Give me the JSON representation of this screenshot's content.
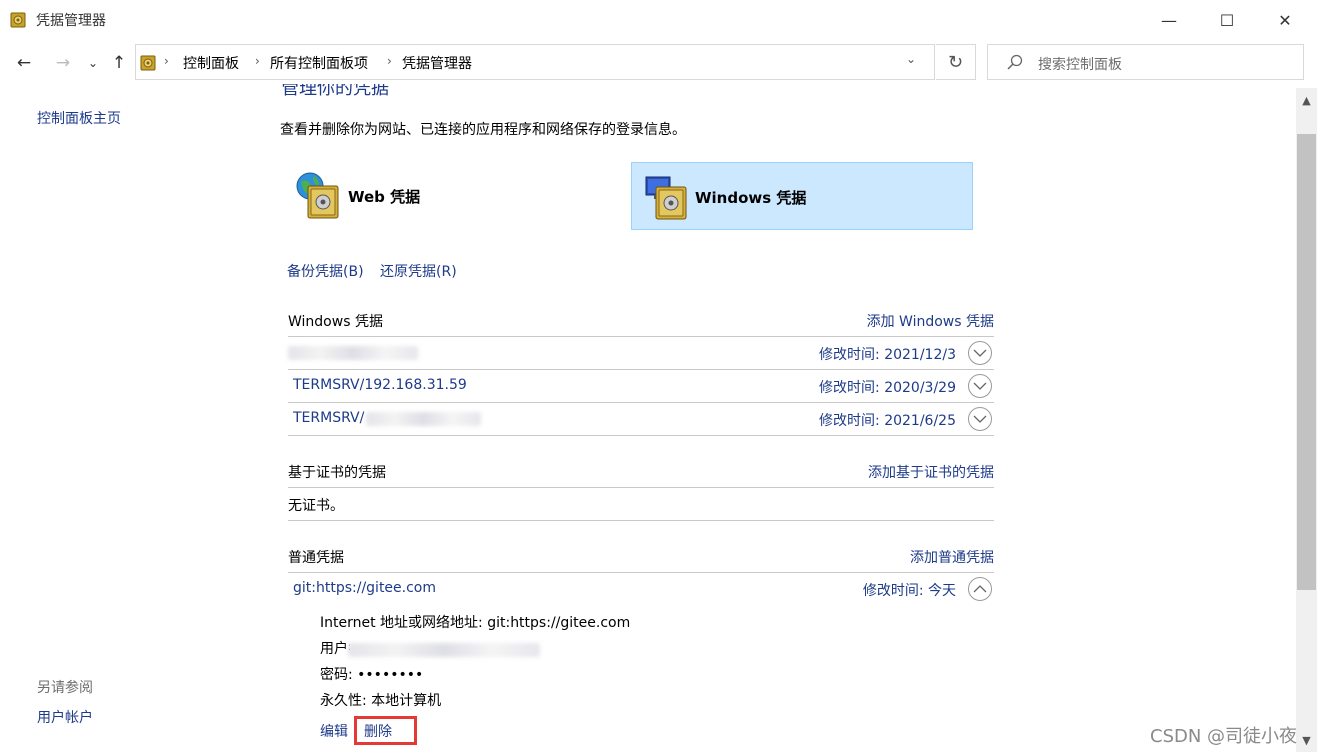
{
  "window": {
    "title": "凭据管理器",
    "minimize_glyph": "—",
    "maximize_glyph": "☐",
    "close_glyph": "✕"
  },
  "nav": {
    "back_glyph": "←",
    "forward_glyph": "→",
    "recent_glyph": "⌄",
    "up_glyph": "↑",
    "breadcrumbs": [
      "控制面板",
      "所有控制面板项",
      "凭据管理器"
    ],
    "separator": "›",
    "dropdown_glyph": "⌄",
    "refresh_glyph": "↻",
    "search_placeholder": "搜索控制面板"
  },
  "sidebar": {
    "home": "控制面板主页",
    "see_also": "另请参阅",
    "user_accounts": "用户帐户"
  },
  "main": {
    "title": "管理你的凭据",
    "description": "查看并删除你为网站、已连接的应用程序和网络保存的登录信息。",
    "tiles": {
      "web": "Web 凭据",
      "windows": "Windows 凭据"
    },
    "selected_tile": "windows",
    "backup": "备份凭据(B)",
    "restore": "还原凭据(R)",
    "windows_section": {
      "title": "Windows 凭据",
      "add": "添加 Windows 凭据",
      "items": [
        {
          "name": "",
          "modified": "修改时间:  2021/12/3"
        },
        {
          "name": "TERMSRV/192.168.31.59",
          "modified": "修改时间:  2020/3/29"
        },
        {
          "name": "TERMSRV/",
          "modified": "修改时间:  2021/6/25"
        }
      ]
    },
    "cert_section": {
      "title": "基于证书的凭据",
      "add": "添加基于证书的凭据",
      "empty": "无证书。"
    },
    "generic_section": {
      "title": "普通凭据",
      "add": "添加普通凭据",
      "items": [
        {
          "name": "git:https://gitee.com",
          "modified": "修改时间:  今天"
        }
      ],
      "expanded": {
        "address": "Internet 地址或网络地址:  git:https://gitee.com",
        "user": "用户名",
        "password": "密码:  ••••••••",
        "persistence": "永久性:  本地计算机",
        "edit": "编辑",
        "delete": "删除"
      }
    }
  },
  "scrollbar": {
    "up_glyph": "▲",
    "down_glyph": "▼"
  },
  "watermark": "CSDN @司徒小夜",
  "colors": {
    "link": "#1e3b8a",
    "selected_tile": "#cce8ff",
    "highlight_box": "#e53935"
  }
}
